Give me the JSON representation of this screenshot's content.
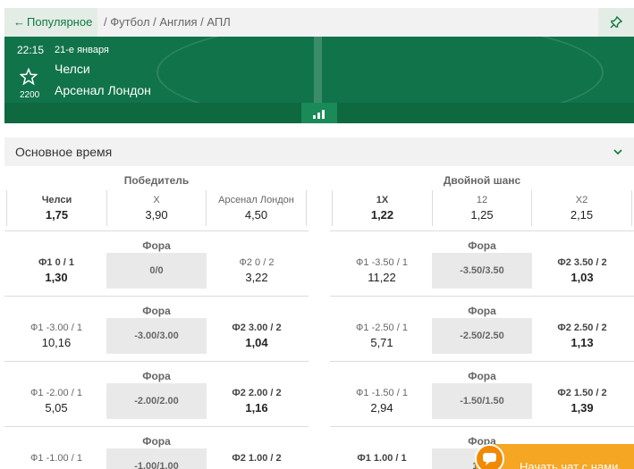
{
  "breadcrumb": {
    "back_label": "Популярное",
    "path": "/ Футбол / Англия / АПЛ"
  },
  "event": {
    "time": "22:15",
    "date": "21-е января",
    "team1": "Челси",
    "team2": "Арсенал Лондон",
    "favorites_count": "2200"
  },
  "section": {
    "title": "Основное время"
  },
  "markets": {
    "winner": {
      "title": "Победитель",
      "cells": [
        {
          "label": "Челси",
          "odd": "1,75"
        },
        {
          "label": "X",
          "odd": "3,90"
        },
        {
          "label": "Арсенал Лондон",
          "odd": "4,50"
        }
      ]
    },
    "double_chance": {
      "title": "Двойной шанс",
      "cells": [
        {
          "label": "1X",
          "odd": "1,22"
        },
        {
          "label": "12",
          "odd": "1,25"
        },
        {
          "label": "X2",
          "odd": "2,15"
        }
      ]
    },
    "handicap_left": [
      {
        "title": "Фора",
        "left_label": "Ф1 0 / 1",
        "left_odd": "1,30",
        "mid": "0/0",
        "right_label": "Ф2 0 / 2",
        "right_odd": "3,22"
      },
      {
        "title": "Фора",
        "left_label": "Ф1 -3.00 / 1",
        "left_odd": "10,16",
        "mid": "-3.00/3.00",
        "right_label": "Ф2 3.00 / 2",
        "right_odd": "1,04"
      },
      {
        "title": "Фора",
        "left_label": "Ф1 -2.00 / 1",
        "left_odd": "5,05",
        "mid": "-2.00/2.00",
        "right_label": "Ф2 2.00 / 2",
        "right_odd": "1,16"
      },
      {
        "title": "Фора",
        "left_label": "Ф1 -1.00 / 1",
        "left_odd": "",
        "mid": "-1.00/1.00",
        "right_label": "Ф2 1.00 / 2",
        "right_odd": ""
      }
    ],
    "handicap_right": [
      {
        "title": "Фора",
        "left_label": "Ф1 -3.50 / 1",
        "left_odd": "11,22",
        "mid": "-3.50/3.50",
        "right_label": "Ф2 3.50 / 2",
        "right_odd": "1,03"
      },
      {
        "title": "Фора",
        "left_label": "Ф1 -2.50 / 1",
        "left_odd": "5,71",
        "mid": "-2.50/2.50",
        "right_label": "Ф2 2.50 / 2",
        "right_odd": "1,13"
      },
      {
        "title": "Фора",
        "left_label": "Ф1 -1.50 / 1",
        "left_odd": "2,94",
        "mid": "-1.50/1.50",
        "right_label": "Ф2 1.50 / 2",
        "right_odd": "1,39"
      },
      {
        "title": "Фора",
        "left_label": "Ф1 1.00 / 1",
        "left_odd": "",
        "mid": "1.00",
        "right_label": "",
        "right_odd": ""
      }
    ]
  },
  "chat": {
    "label": "Начать чат с нами"
  },
  "colors": {
    "brand_green": "#11734a",
    "accent_green": "#0c7a3e",
    "chat_orange": "#f5a623"
  }
}
